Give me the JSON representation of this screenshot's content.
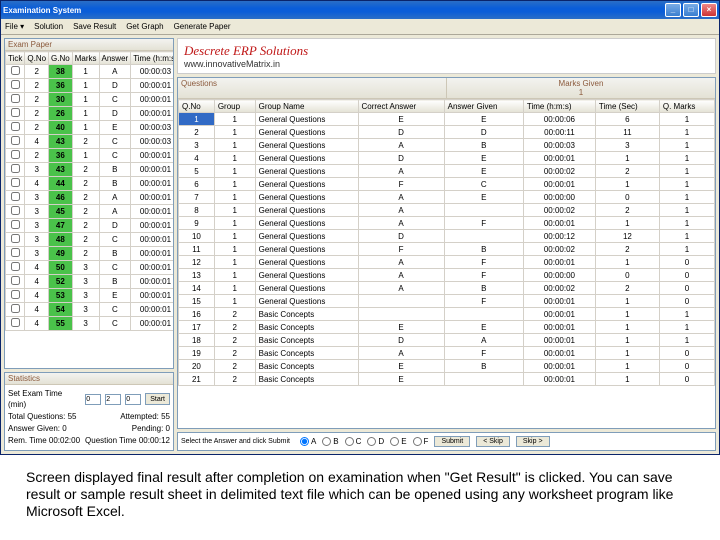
{
  "window": {
    "title": "Examination System"
  },
  "menu": {
    "file": "File ▾",
    "solution": "Solution",
    "save": "Save Result",
    "graph": "Get Graph",
    "generate": "Generate Paper"
  },
  "winbtn": {
    "min": "_",
    "max": "□",
    "close": "×"
  },
  "logo": {
    "line1": "Descrete ERP Solutions",
    "line2": "www.innovativeMatrix.in"
  },
  "left_hdr": "Exam Paper",
  "exam_cols": [
    "Tick",
    "Q.No",
    "G.No",
    "Marks",
    "Answer",
    "Time (h:m:s)"
  ],
  "exam_rows": [
    [
      "2",
      "38",
      "1",
      "A",
      "00:00:03"
    ],
    [
      "2",
      "36",
      "1",
      "D",
      "00:00:01"
    ],
    [
      "2",
      "30",
      "1",
      "C",
      "00:00:01"
    ],
    [
      "2",
      "26",
      "1",
      "D",
      "00:00:01"
    ],
    [
      "2",
      "40",
      "1",
      "E",
      "00:00:03"
    ],
    [
      "4",
      "43",
      "2",
      "C",
      "00:00:03"
    ],
    [
      "2",
      "36",
      "1",
      "C",
      "00:00:01"
    ],
    [
      "3",
      "43",
      "2",
      "B",
      "00:00:01"
    ],
    [
      "4",
      "44",
      "2",
      "B",
      "00:00:01"
    ],
    [
      "3",
      "46",
      "2",
      "A",
      "00:00:01"
    ],
    [
      "3",
      "45",
      "2",
      "A",
      "00:00:01"
    ],
    [
      "3",
      "47",
      "2",
      "D",
      "00:00:01"
    ],
    [
      "3",
      "48",
      "2",
      "C",
      "00:00:01"
    ],
    [
      "3",
      "49",
      "2",
      "B",
      "00:00:01"
    ],
    [
      "4",
      "50",
      "3",
      "C",
      "00:00:01"
    ],
    [
      "4",
      "52",
      "3",
      "B",
      "00:00:01"
    ],
    [
      "4",
      "53",
      "3",
      "E",
      "00:00:01"
    ],
    [
      "4",
      "54",
      "3",
      "C",
      "00:00:01"
    ],
    [
      "4",
      "55",
      "3",
      "C",
      "00:00:01"
    ]
  ],
  "stats": {
    "hdr": "Statistics",
    "set_time": "Set Exam Time (min)",
    "h": "0",
    "m": "2",
    "s": "0",
    "start": "Start",
    "l1a": "Total Questions: 55",
    "l1b": "Attempted: 55",
    "l2a": "Answer Given: 0",
    "l2b": "Pending: 0",
    "l3a": "Rem. Time 00:02:00",
    "l3b": "Question Time 00:00:12"
  },
  "q_hdr": "Questions",
  "marks_hdr": "Marks Given",
  "marks_val": "1",
  "q_cols": [
    "Q.No",
    "Group",
    "Group Name",
    "Correct Answer",
    "Answer Given",
    "Time (h:m:s)",
    "Time (Sec)",
    "Q. Marks"
  ],
  "q_rows": [
    [
      "1",
      "1",
      "General Questions",
      "E",
      "E",
      "00:00:06",
      "6",
      "1"
    ],
    [
      "2",
      "1",
      "General Questions",
      "D",
      "D",
      "00:00:11",
      "11",
      "1"
    ],
    [
      "3",
      "1",
      "General Questions",
      "A",
      "B",
      "00:00:03",
      "3",
      "1"
    ],
    [
      "4",
      "1",
      "General Questions",
      "D",
      "E",
      "00:00:01",
      "1",
      "1"
    ],
    [
      "5",
      "1",
      "General Questions",
      "A",
      "E",
      "00:00:02",
      "2",
      "1"
    ],
    [
      "6",
      "1",
      "General Questions",
      "F",
      "C",
      "00:00:01",
      "1",
      "1"
    ],
    [
      "7",
      "1",
      "General Questions",
      "A",
      "E",
      "00:00:00",
      "0",
      "1"
    ],
    [
      "8",
      "1",
      "General Questions",
      "A",
      "",
      "00:00:02",
      "2",
      "1"
    ],
    [
      "9",
      "1",
      "General Questions",
      "A",
      "F",
      "00:00:01",
      "1",
      "1"
    ],
    [
      "10",
      "1",
      "General Questions",
      "D",
      "",
      "00:00:12",
      "12",
      "1"
    ],
    [
      "11",
      "1",
      "General Questions",
      "F",
      "B",
      "00:00:02",
      "2",
      "1"
    ],
    [
      "12",
      "1",
      "General Questions",
      "A",
      "F",
      "00:00:01",
      "1",
      "0"
    ],
    [
      "13",
      "1",
      "General Questions",
      "A",
      "F",
      "00:00:00",
      "0",
      "0"
    ],
    [
      "14",
      "1",
      "General Questions",
      "A",
      "B",
      "00:00:02",
      "2",
      "0"
    ],
    [
      "15",
      "1",
      "General Questions",
      "",
      "F",
      "00:00:01",
      "1",
      "0"
    ],
    [
      "16",
      "2",
      "Basic Concepts",
      "",
      "",
      "00:00:01",
      "1",
      "1"
    ],
    [
      "17",
      "2",
      "Basic Concepts",
      "E",
      "E",
      "00:00:01",
      "1",
      "1"
    ],
    [
      "18",
      "2",
      "Basic Concepts",
      "D",
      "A",
      "00:00:01",
      "1",
      "1"
    ],
    [
      "19",
      "2",
      "Basic Concepts",
      "A",
      "F",
      "00:00:01",
      "1",
      "0"
    ],
    [
      "20",
      "2",
      "Basic Concepts",
      "E",
      "B",
      "00:00:01",
      "1",
      "0"
    ],
    [
      "21",
      "2",
      "Basic Concepts",
      "E",
      "",
      "00:00:01",
      "1",
      "0"
    ]
  ],
  "ans": {
    "prompt": "Select the Answer and click Submit",
    "a": "A",
    "b": "B",
    "c": "C",
    "d": "D",
    "e": "E",
    "f": "F",
    "submit": "Submit",
    "back": "< Skip",
    "next": "Skip >"
  },
  "caption": "Screen displayed final result after completion on examination when \"Get Result\" is clicked. You can save result or sample result sheet in delimited text file which can be opened using any worksheet program like Microsoft Excel."
}
